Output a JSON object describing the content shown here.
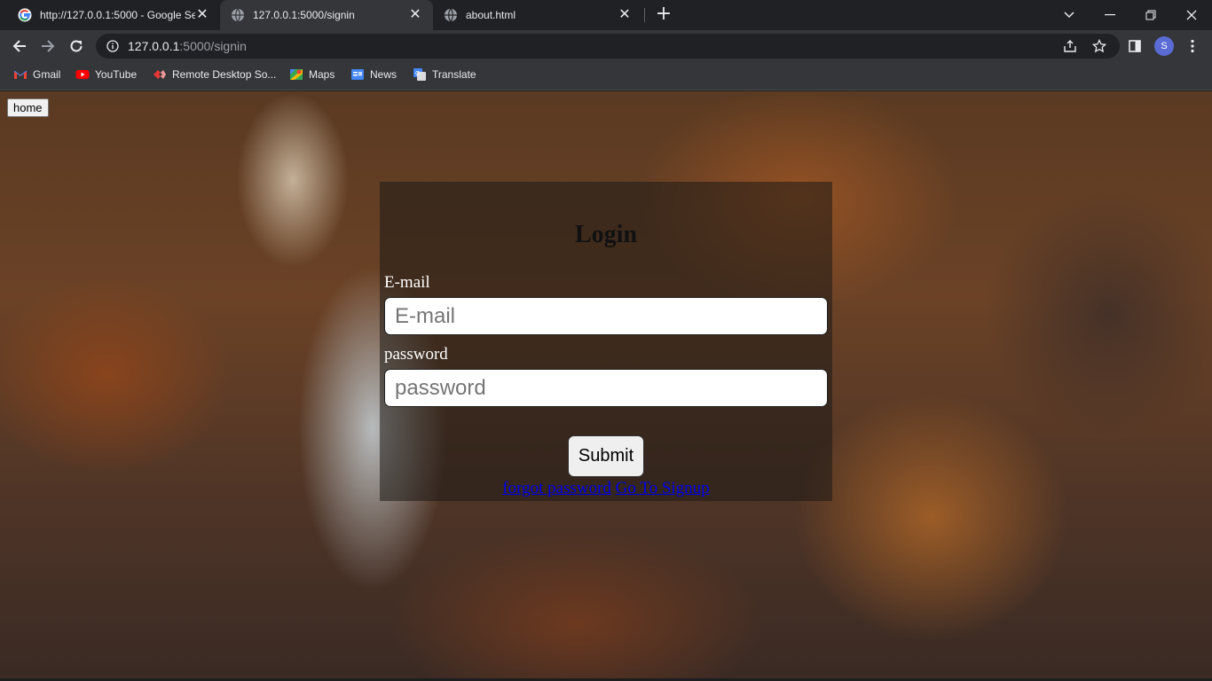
{
  "browser": {
    "tabs": [
      {
        "title": "http://127.0.0.1:5000 - Google Se",
        "icon": "google-icon",
        "active": false
      },
      {
        "title": "127.0.0.1:5000/signin",
        "icon": "globe-icon",
        "active": true
      },
      {
        "title": "about.html",
        "icon": "globe-icon",
        "active": false
      }
    ],
    "url_host": "127.0.0.1",
    "url_path": ":5000/signin",
    "profile_initial": "S",
    "bookmarks": [
      {
        "label": "Gmail",
        "icon": "gmail-icon"
      },
      {
        "label": "YouTube",
        "icon": "youtube-icon"
      },
      {
        "label": "Remote Desktop So...",
        "icon": "remote-desktop-icon"
      },
      {
        "label": "Maps",
        "icon": "maps-icon"
      },
      {
        "label": "News",
        "icon": "news-icon"
      },
      {
        "label": "Translate",
        "icon": "translate-icon"
      }
    ]
  },
  "page": {
    "home_label": "home",
    "login": {
      "title": "Login",
      "email_label": "E-mail",
      "email_placeholder": "E-mail",
      "password_label": "password",
      "password_placeholder": "password",
      "submit_label": "Submit",
      "forgot_link": "forgot password",
      "signup_link": "Go To Signup"
    }
  },
  "colors": {
    "chrome_dark": "#202124",
    "chrome_toolbar": "#35363a",
    "link": "#0000ee",
    "avatar": "#5b6bd5"
  }
}
